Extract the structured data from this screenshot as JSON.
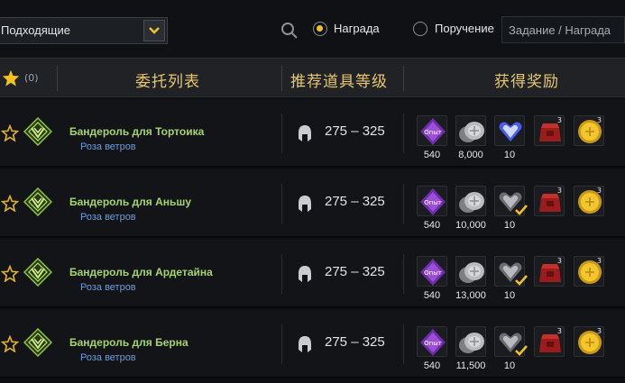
{
  "filters": {
    "dropdown_value": "Подходящие",
    "radio_reward": "Награда",
    "radio_commission": "Поручение",
    "search_placeholder": "Задание / Награда",
    "accent": "#f4c21a"
  },
  "header": {
    "fav_count": "(0)",
    "col_list": "委托列表",
    "col_level": "推荐道具等级",
    "col_reward": "获得奖励"
  },
  "rows": [
    {
      "name": "Бандероль для Тортоика",
      "location": "Роза ветров",
      "level": "275 – 325",
      "rewards": [
        {
          "icon": "exp-crystal-icon",
          "label": "540"
        },
        {
          "icon": "silver-coins-icon",
          "label": "8,000"
        },
        {
          "icon": "blue-heart-gem-icon",
          "label": "10"
        },
        {
          "icon": "red-pouch-icon",
          "count": "3"
        },
        {
          "icon": "gold-coin-icon",
          "count": "3"
        }
      ]
    },
    {
      "name": "Бандероль для Аньшу",
      "location": "Роза ветров",
      "level": "275 – 325",
      "rewards": [
        {
          "icon": "exp-crystal-icon",
          "label": "540"
        },
        {
          "icon": "silver-coins-icon",
          "label": "10,000"
        },
        {
          "icon": "grey-heart-gem-icon",
          "label": "10"
        },
        {
          "icon": "red-pouch-icon",
          "count": "3"
        },
        {
          "icon": "gold-coin-icon",
          "count": "3"
        }
      ]
    },
    {
      "name": "Бандероль для Ардетайна",
      "location": "Роза ветров",
      "level": "275 – 325",
      "rewards": [
        {
          "icon": "exp-crystal-icon",
          "label": "540"
        },
        {
          "icon": "silver-coins-icon",
          "label": "13,000"
        },
        {
          "icon": "grey-heart-gem-icon",
          "label": "10"
        },
        {
          "icon": "red-pouch-icon",
          "count": "3"
        },
        {
          "icon": "gold-coin-icon",
          "count": "3"
        }
      ]
    },
    {
      "name": "Бандероль для Берна",
      "location": "Роза ветров",
      "level": "275 – 325",
      "rewards": [
        {
          "icon": "exp-crystal-icon",
          "label": "540"
        },
        {
          "icon": "silver-coins-icon",
          "label": "11,500"
        },
        {
          "icon": "grey-heart-gem-icon",
          "label": "10"
        },
        {
          "icon": "red-pouch-icon",
          "count": "3"
        },
        {
          "icon": "gold-coin-icon",
          "count": "3"
        }
      ]
    }
  ]
}
